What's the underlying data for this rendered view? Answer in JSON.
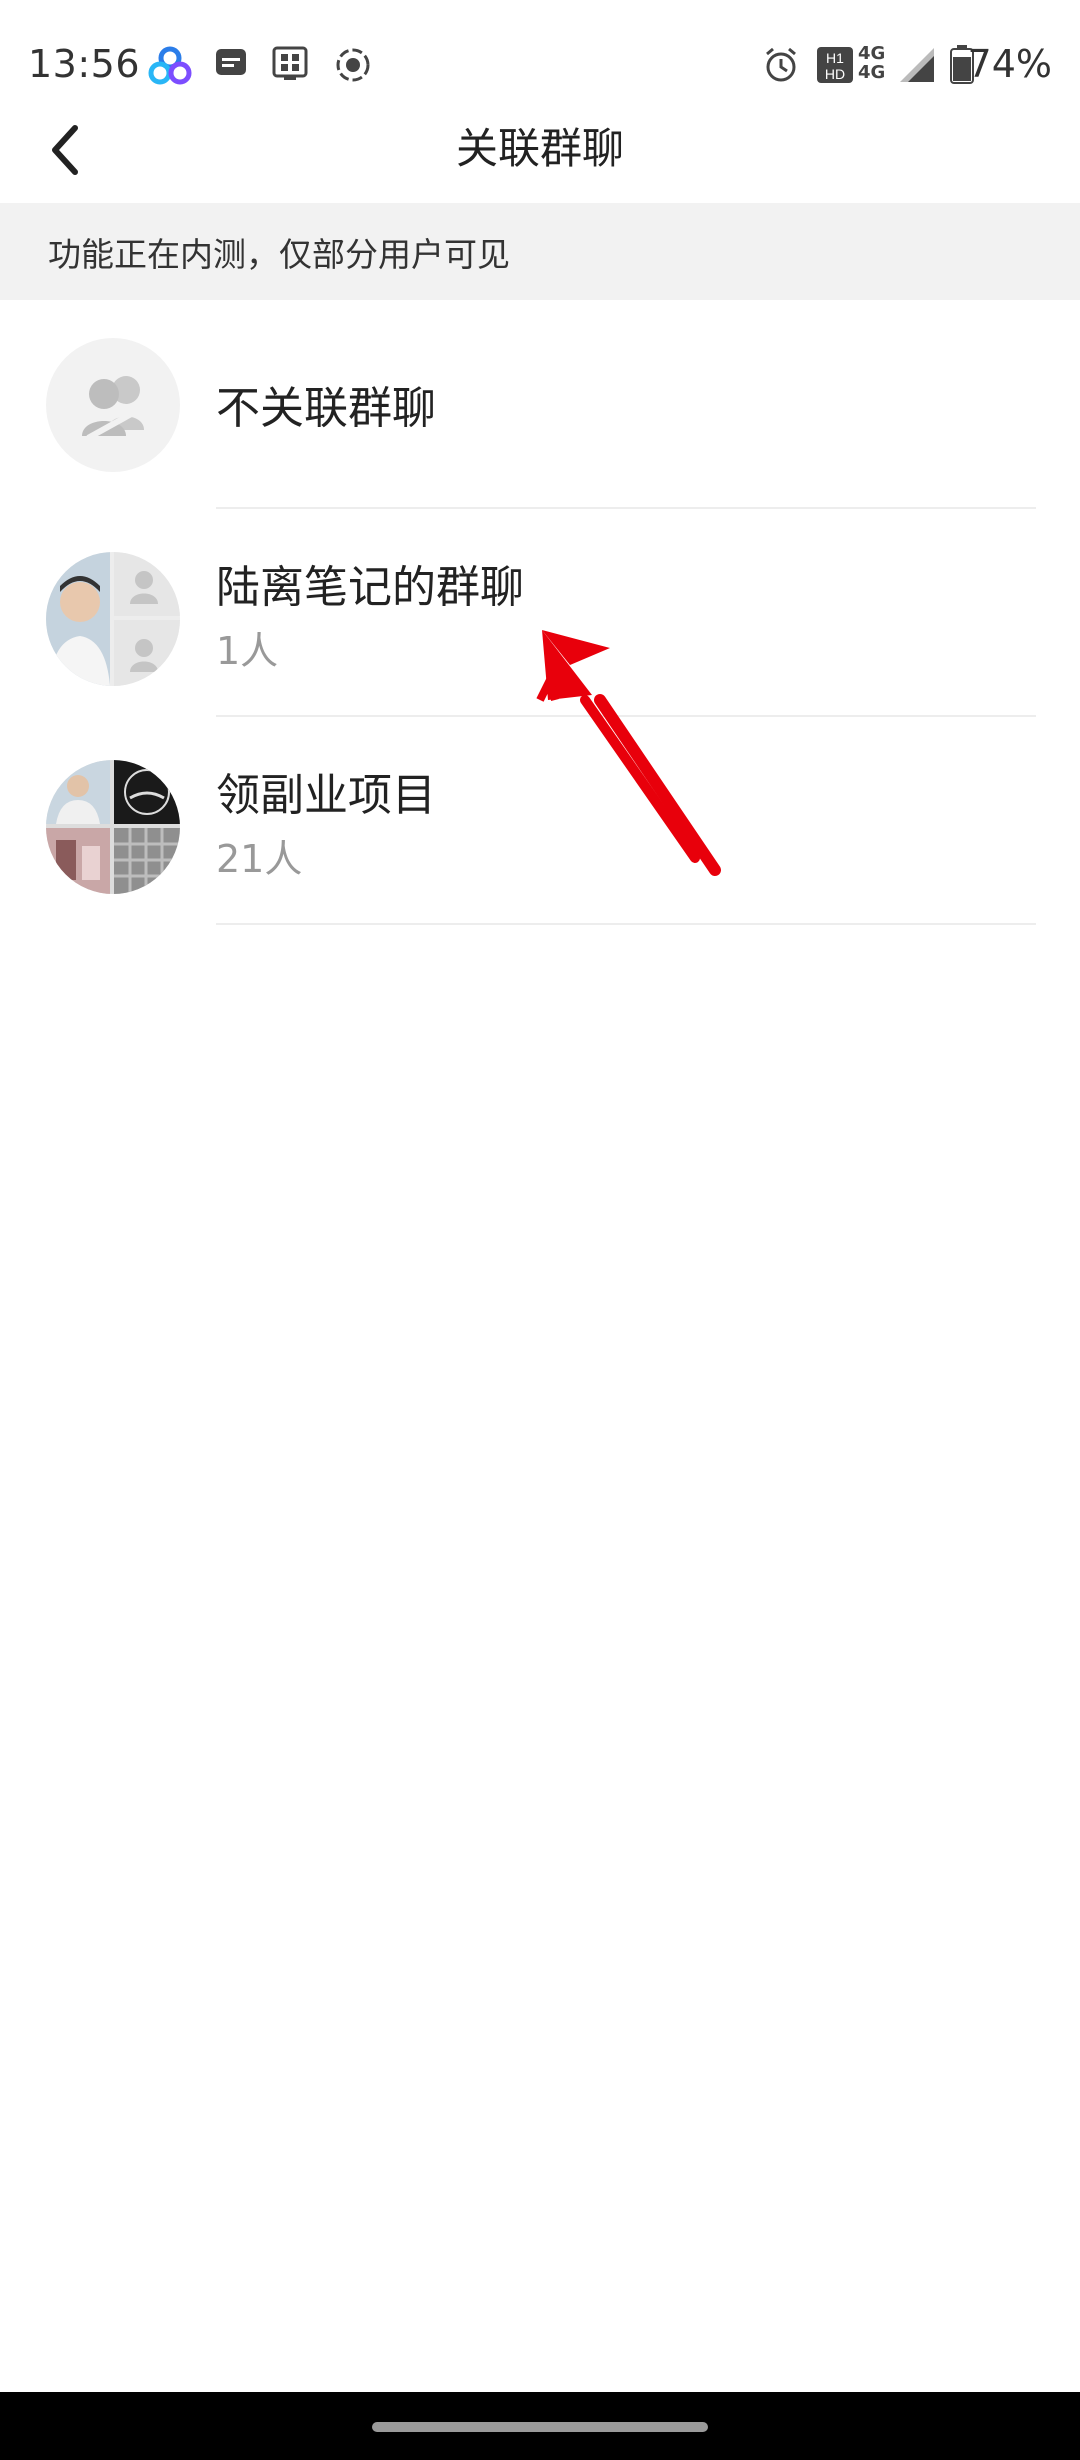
{
  "status_bar": {
    "time": "13:56",
    "battery_percent": "74%",
    "network_labels": [
      "4G",
      "4G"
    ],
    "icons": [
      "baidu-cloud-icon",
      "message-icon",
      "app-grid-icon",
      "screen-record-icon",
      "alarm-icon",
      "hd-signal-icon",
      "cell-signal-icon",
      "battery-icon"
    ]
  },
  "header": {
    "title": "关联群聊",
    "back_icon": "chevron-left-icon"
  },
  "notice": {
    "text": "功能正在内测，仅部分用户可见"
  },
  "list": {
    "items": [
      {
        "title": "不关联群聊",
        "subtitle": "",
        "avatar": "group-placeholder-icon"
      },
      {
        "title": "陆离笔记的群聊",
        "subtitle": "1人",
        "avatar": "group-avatar-collage"
      },
      {
        "title": "领副业项目",
        "subtitle": "21人",
        "avatar": "group-avatar-collage"
      }
    ]
  },
  "colors": {
    "notice_bg": "#f2f2f2",
    "annotation_arrow": "#e8000b",
    "subtitle": "#999999",
    "nav_bar": "#000000"
  }
}
